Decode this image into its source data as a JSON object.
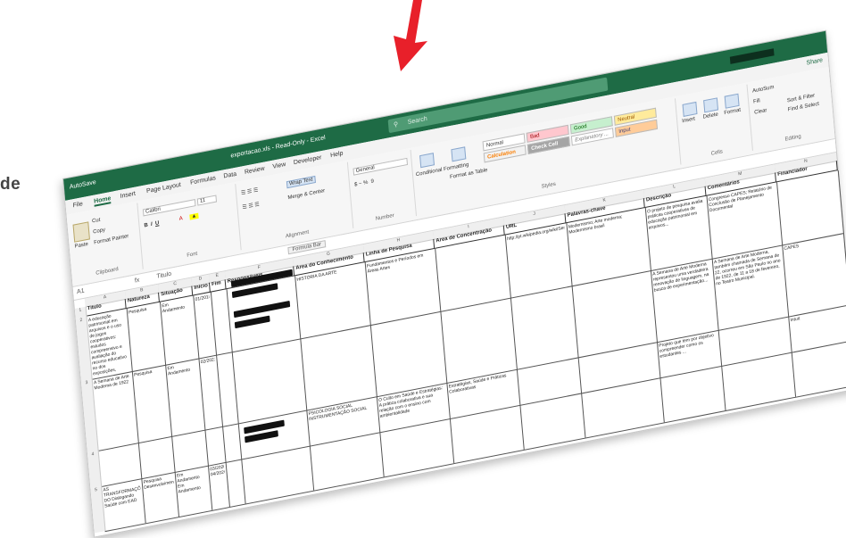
{
  "background_fragment": "de",
  "titlebar": {
    "autosave": "AutoSave",
    "filename": "exportacao.xls - Read-Only - Excel",
    "search_placeholder": "Search"
  },
  "tabs": [
    "File",
    "Home",
    "Insert",
    "Page Layout",
    "Formulas",
    "Data",
    "Review",
    "View",
    "Developer",
    "Help"
  ],
  "share_label": "Share",
  "ribbon": {
    "clipboard": {
      "paste": "Paste",
      "cut": "Cut",
      "copy": "Copy",
      "format_painter": "Format Painter",
      "label": "Clipboard"
    },
    "font": {
      "name": "Calibri",
      "size": "11",
      "label": "Font"
    },
    "alignment": {
      "wrap_text": "Wrap Text",
      "merge_center": "Merge & Center",
      "label": "Alignment"
    },
    "number": {
      "format": "General",
      "label": "Number"
    },
    "styles": {
      "conditional_formatting": "Conditional Formatting",
      "format_as_table": "Format as Table",
      "cells": [
        "Normal",
        "Bad",
        "Good",
        "Neutral",
        "Calculation",
        "Check Cell",
        "Explanatory ...",
        "Input"
      ],
      "label": "Styles"
    },
    "cells": {
      "insert": "Insert",
      "delete": "Delete",
      "format": "Format",
      "label": "Cells"
    },
    "editing": {
      "autosum": "AutoSum",
      "fill": "Fill",
      "clear": "Clear",
      "sort_filter": "Sort & Filter",
      "find_select": "Find & Select",
      "label": "Editing"
    }
  },
  "formula_bar": {
    "name_box": "A1",
    "fx": "fx",
    "content": "Titulo",
    "tooltip": "Formula Bar"
  },
  "columns": [
    "A",
    "B",
    "C",
    "D",
    "E",
    "F",
    "G",
    "H",
    "I",
    "J",
    "K",
    "L",
    "M",
    "N"
  ],
  "headers": [
    "Titulo",
    "Natureza",
    "Situação",
    "Início",
    "Fim",
    "Responsáveis",
    "Área do Conhecimento",
    "Linha de Pesquisa",
    "Área de Concentração",
    "URL",
    "Palavras-chave",
    "Descrição",
    "Comentários",
    "Financiador"
  ],
  "rows": [
    {
      "num": "2",
      "cells": {
        "A": "A educação patrimonial em arquivos e o uso de jogos cooperativos: estudos compreensivo e avaliação do recurso educativo no dos exposições, abordagens e nível de utilização",
        "B": "Pesquisa",
        "C": "Em Andamento",
        "D": "01/2018",
        "G": "HISTÓRIA DA ARTE",
        "H": "Fundamentos e Períodos em Áreas Artes",
        "J": "http://pt.wikipedia.org/wiki/Semana_de_Arte_Moderna",
        "K": "Modernismo; Arte moderna; Modernismo brasil",
        "L": "O projeto de pesquisa avalia práticas cooperativas de educação patrimonial em arquivos...",
        "M": "Congresso CAPES; Relatório de Conclusão de Planejamento Documental",
        "N": ""
      }
    },
    {
      "num": "3",
      "cells": {
        "A": "A Semana de Arte Moderna de 1922",
        "B": "Pesquisa",
        "C": "Em Andamento",
        "D": "02/2022",
        "L": "A Semana de Arte Moderna representou uma verdadeira renovação de linguagem, na busca de experimentação...",
        "M": "A Semana de Arte Moderna, também chamada de Semana de 22, ocorreu em São Paulo no ano de 1922, de 11 a 18 de fevereiro, no Teatro Municipal.",
        "N": "CAPES"
      }
    },
    {
      "num": "4",
      "cells": {
        "G": "PSICOLOGIA SOCIAL INSTRUMENTAÇÃO SOCIAL",
        "H": "O Culto em Saúde e Estratégias: A prática colaborativa e sua relação com o ensino com ambientalidade",
        "I": "Estratégias, Saúde e Práticas Colaborativas",
        "L": "Projeto que tem por objetivo compreender como os estudantes ...",
        "N": "Intuit"
      }
    },
    {
      "num": "5",
      "cells": {
        "A": "AS TRANSFORMAÇÕES DO Dialogando Saúde com EAD",
        "B": "Pesquisa Desenvolvimento",
        "C": "Em Andamento Em Andamento",
        "D": "03/2020 04/2020"
      }
    }
  ]
}
